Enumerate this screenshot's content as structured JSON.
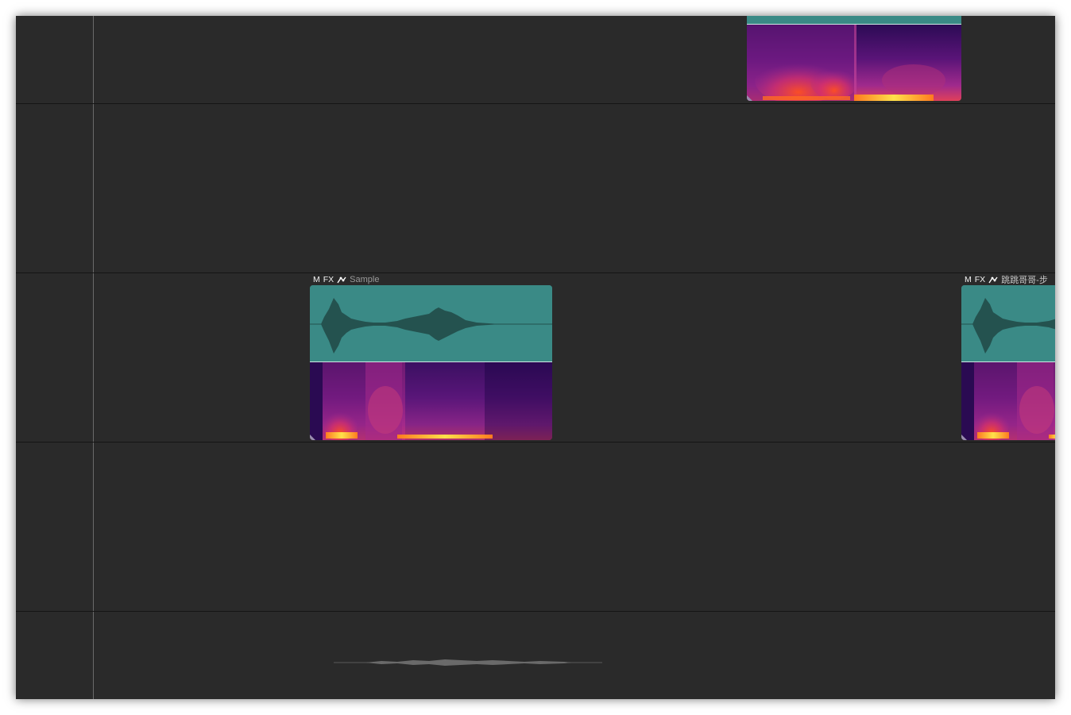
{
  "tracks": [
    {
      "index": 1,
      "clips": [
        {
          "header_visible": false,
          "name": "",
          "type": "audio",
          "view": "waveform+spectrogram"
        }
      ]
    },
    {
      "index": 2,
      "clips": []
    },
    {
      "index": 3,
      "clips": [
        {
          "mute_label": "M",
          "fx_label": "FX",
          "envelope_icon": "envelope-icon",
          "name": "Sample"
        },
        {
          "mute_label": "M",
          "fx_label": "FX",
          "envelope_icon": "envelope-icon",
          "name": "跳跳哥哥-步"
        }
      ]
    },
    {
      "index": 4,
      "clips": []
    },
    {
      "index": 5,
      "clips": [],
      "overview_waveform": true
    }
  ],
  "colors": {
    "background": "#2a2a2a",
    "track_separator": "#141414",
    "clip_waveform_bg": "#3a8a86",
    "waveform_fill": "#24524f",
    "spectrogram_low": "#2a0a52",
    "spectrogram_mid": "#b0208a",
    "spectrogram_high": "#ff5a1a",
    "spectrogram_peak": "#ffe14a"
  }
}
